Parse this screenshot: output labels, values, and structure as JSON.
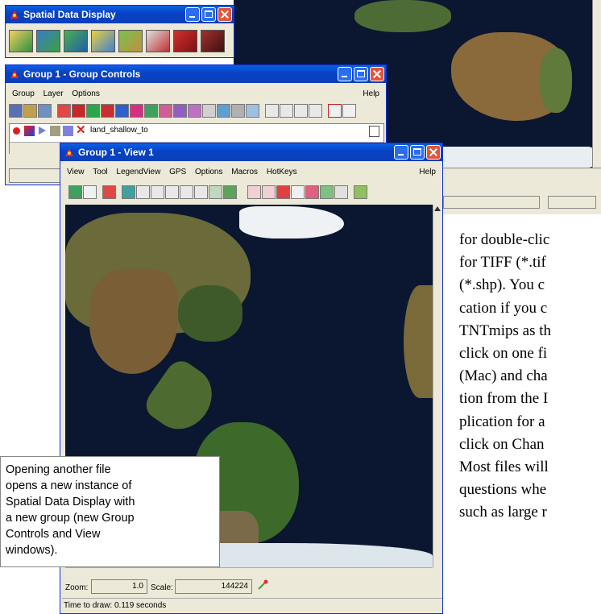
{
  "spatial_window": {
    "title": "Spatial Data Display"
  },
  "group_controls": {
    "title": "Group 1 - Group Controls",
    "menu": [
      "Group",
      "Layer",
      "Options"
    ],
    "help": "Help",
    "layer_name": "land_shallow_to"
  },
  "view_window": {
    "title": "Group 1 - View 1",
    "menu": [
      "View",
      "Tool",
      "LegendView",
      "GPS",
      "Options",
      "Macros",
      "HotKeys"
    ],
    "help": "Help",
    "zoom_label": "Zoom:",
    "zoom_value": "1.0",
    "scale_label": "Scale:",
    "scale_value": "144224",
    "status": "Time to draw: 0.119 seconds"
  },
  "callout": {
    "lines": [
      "Opening another file",
      "opens a new instance of",
      "Spatial Data Display with",
      "a new group (new Group",
      "Controls and View",
      "windows)."
    ]
  },
  "body_text": {
    "lines": [
      "for double-clic",
      "for TIFF (*.tif",
      "(*.shp).  You c",
      "cation if you c",
      "TNTmips as th",
      "click on one fi",
      "(Mac) and cha",
      "tion from the I",
      "plication for a",
      "click on Chan",
      "Most files will",
      "questions whe",
      "such as large r"
    ]
  },
  "colors": {
    "title_blue": "#0842c4",
    "window_face": "#ece9d8",
    "ocean": "#0b1630"
  }
}
